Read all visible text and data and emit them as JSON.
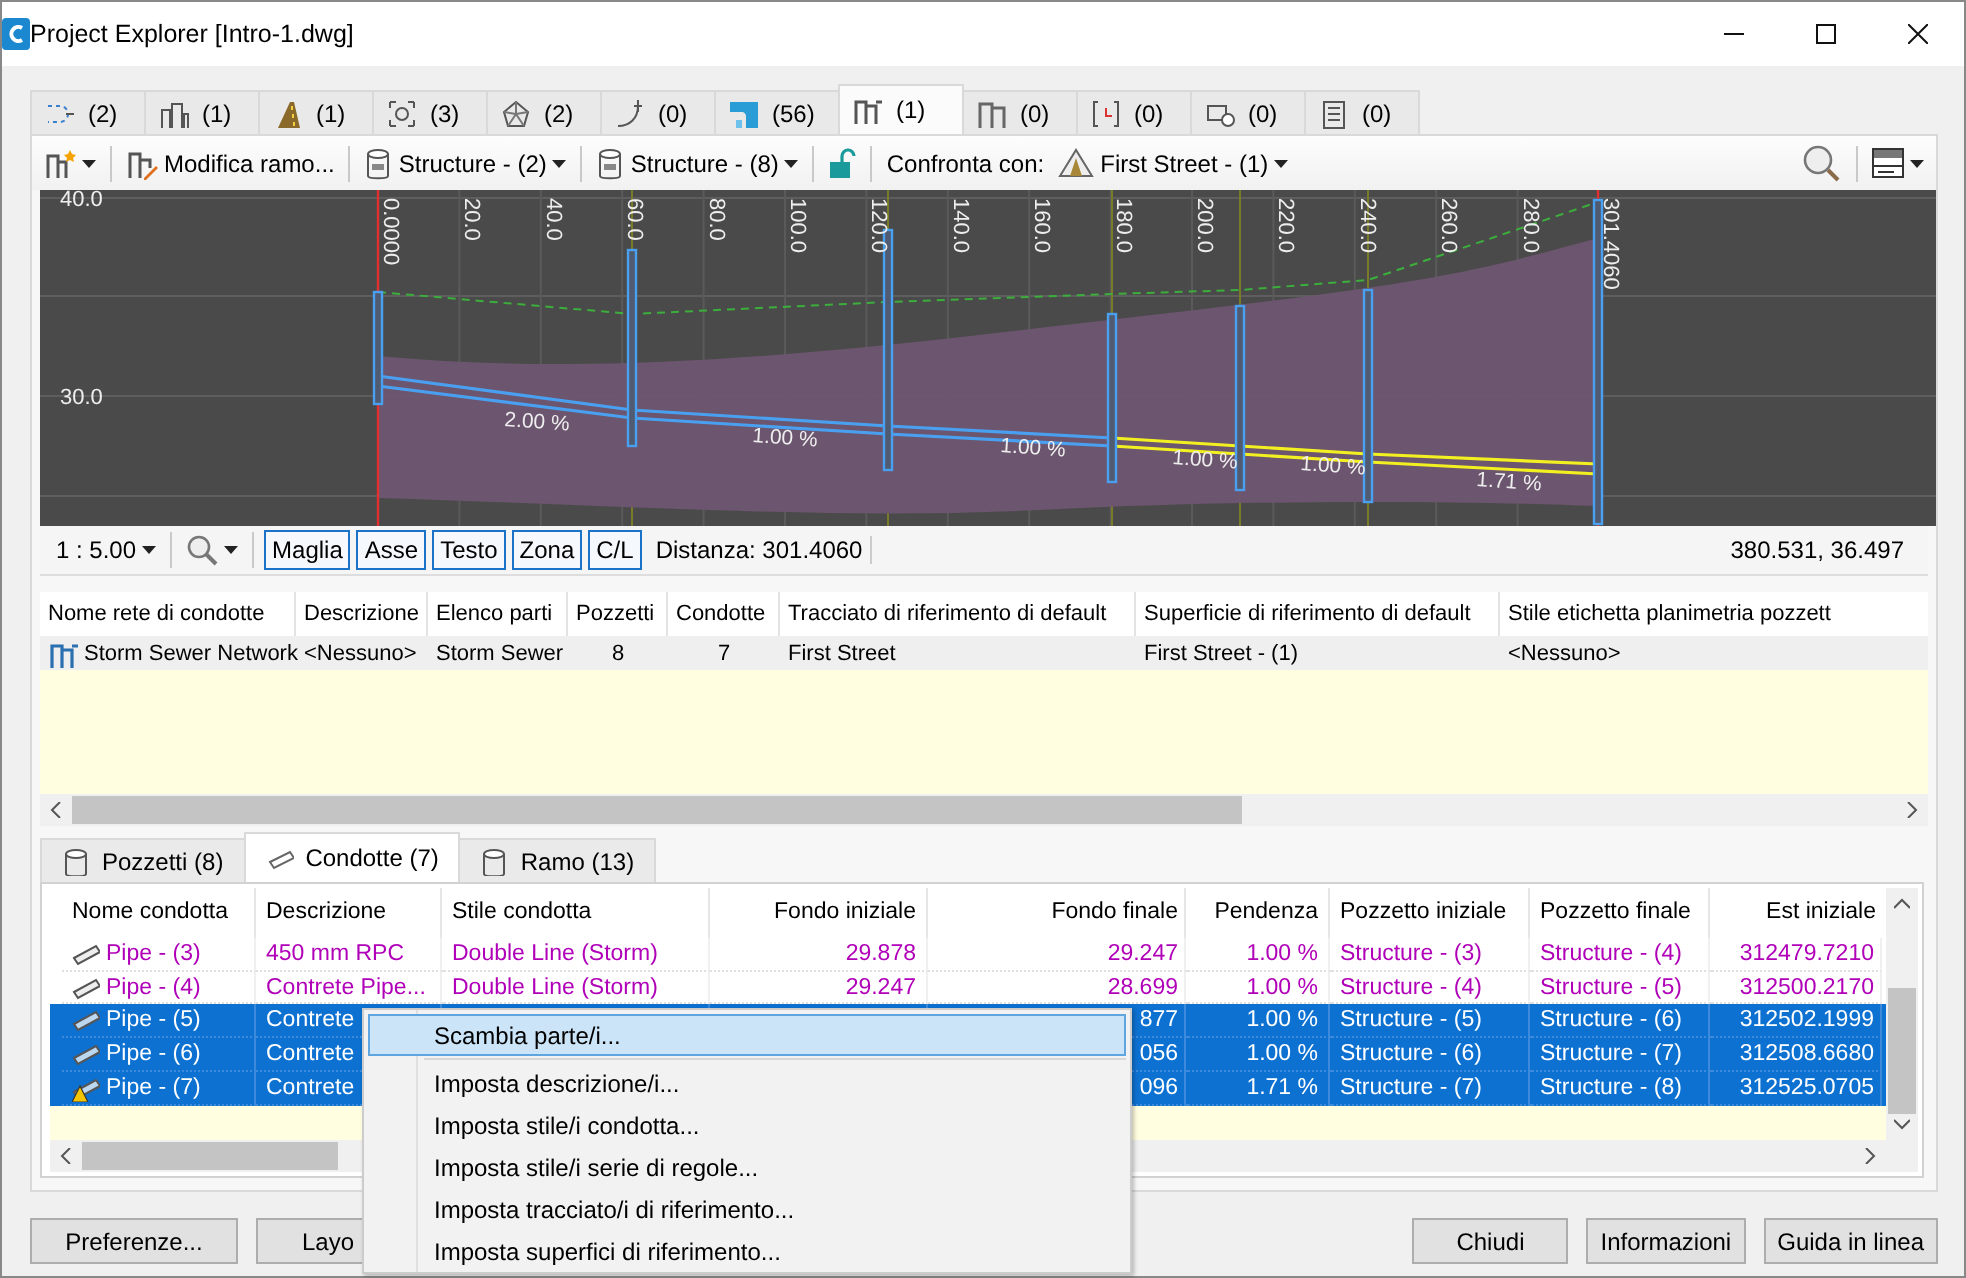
{
  "window": {
    "title": "Project Explorer [Intro-1.dwg]"
  },
  "object_tabs": [
    {
      "count": "(2)",
      "selected": false
    },
    {
      "count": "(1)",
      "selected": false
    },
    {
      "count": "(1)",
      "selected": false
    },
    {
      "count": "(3)",
      "selected": false
    },
    {
      "count": "(2)",
      "selected": false
    },
    {
      "count": "(0)",
      "selected": false
    },
    {
      "count": "(56)",
      "selected": false
    },
    {
      "count": "(1)",
      "selected": true
    },
    {
      "count": "(0)",
      "selected": false
    },
    {
      "count": "(0)",
      "selected": false
    },
    {
      "count": "(0)",
      "selected": false
    },
    {
      "count": "(0)",
      "selected": false
    }
  ],
  "toolbar": {
    "modify_button": "Modifica ramo...",
    "structure_dropdowns": [
      "Structure - (2)",
      "Structure - (8)"
    ],
    "compare_label": "Confronta con:",
    "compare_dropdown": "First Street - (1)"
  },
  "profile": {
    "elevation_labels": [
      "40.0",
      "30.0"
    ],
    "station_labels": [
      "0.0000",
      "20.0",
      "40.0",
      "60.0",
      "80.0",
      "100.0",
      "120.0",
      "140.0",
      "160.0",
      "180.0",
      "200.0",
      "220.0",
      "240.0",
      "260.0",
      "280.0",
      "301.4060"
    ],
    "grade_labels": [
      "2.00 %",
      "1.00 %",
      "1.00 %",
      "1.00 %",
      "1.00 %",
      "1.71 %"
    ]
  },
  "profile_status": {
    "scale": "1 : 5.00",
    "toggles": [
      {
        "label": "Maglia",
        "on": true
      },
      {
        "label": "Asse",
        "on": true
      },
      {
        "label": "Testo",
        "on": true
      },
      {
        "label": "Zona",
        "on": true
      },
      {
        "label": "C/L",
        "on": true
      }
    ],
    "distance": "Distanza: 301.4060",
    "coordinates": "380.531, 36.497"
  },
  "network_table": {
    "columns": [
      "Nome rete di condotte",
      "Descrizione",
      "Elenco parti",
      "Pozzetti",
      "Condotte",
      "Tracciato di riferimento di default",
      "Superficie di riferimento di default",
      "Stile etichetta planimetria pozzett"
    ],
    "rows": [
      [
        "Storm Sewer Network",
        "<Nessuno>",
        "Storm Sewer",
        "8",
        "7",
        "First Street",
        "First Street - (1)",
        "<Nessuno>"
      ]
    ]
  },
  "part_tabs": [
    {
      "label": "Pozzetti (8)",
      "selected": false
    },
    {
      "label": "Condotte (7)",
      "selected": true
    },
    {
      "label": "Ramo (13)",
      "selected": false
    }
  ],
  "pipes_table": {
    "columns": [
      "Nome condotta",
      "Descrizione",
      "Stile condotta",
      "Fondo iniziale",
      "Fondo finale",
      "Pendenza",
      "Pozzetto iniziale",
      "Pozzetto finale",
      "Est iniziale"
    ],
    "rows": [
      {
        "selected": false,
        "warning": false,
        "cells": [
          "Pipe - (3)",
          "450 mm RPC",
          "Double Line (Storm)",
          "29.878",
          "29.247",
          "1.00 %",
          "Structure - (3)",
          "Structure - (4)",
          "312479.7210"
        ]
      },
      {
        "selected": false,
        "warning": false,
        "cells": [
          "Pipe - (4)",
          "Contrete Pipe...",
          "Double Line (Storm)",
          "29.247",
          "28.699",
          "1.00 %",
          "Structure - (4)",
          "Structure - (5)",
          "312500.2170"
        ]
      },
      {
        "selected": true,
        "warning": false,
        "cells": [
          "Pipe - (5)",
          "Contrete",
          null,
          null,
          "877",
          "1.00 %",
          "Structure - (5)",
          "Structure - (6)",
          "312502.1999"
        ]
      },
      {
        "selected": true,
        "warning": false,
        "cells": [
          "Pipe - (6)",
          "Contrete",
          null,
          null,
          "056",
          "1.00 %",
          "Structure - (6)",
          "Structure - (7)",
          "312508.6680"
        ]
      },
      {
        "selected": true,
        "warning": true,
        "cells": [
          "Pipe - (7)",
          "Contrete",
          null,
          null,
          "096",
          "1.71 %",
          "Structure - (7)",
          "Structure - (8)",
          "312525.0705"
        ]
      }
    ]
  },
  "context_menu": {
    "items": [
      {
        "label": "Scambia parte/i...",
        "selected": true,
        "separator_after": true
      },
      {
        "label": "Imposta descrizione/i...",
        "selected": false,
        "separator_after": false
      },
      {
        "label": "Imposta stile/i condotta...",
        "selected": false,
        "separator_after": false
      },
      {
        "label": "Imposta stile/i serie di regole...",
        "selected": false,
        "separator_after": false
      },
      {
        "label": "Imposta tracciato/i di riferimento...",
        "selected": false,
        "separator_after": false
      },
      {
        "label": "Imposta superfici di riferimento...",
        "selected": false,
        "separator_after": false
      }
    ]
  },
  "buttons": {
    "left": [
      "Preferenze...",
      "Layo"
    ],
    "right": [
      "Chiudi",
      "Informazioni",
      "Guida in linea"
    ]
  }
}
